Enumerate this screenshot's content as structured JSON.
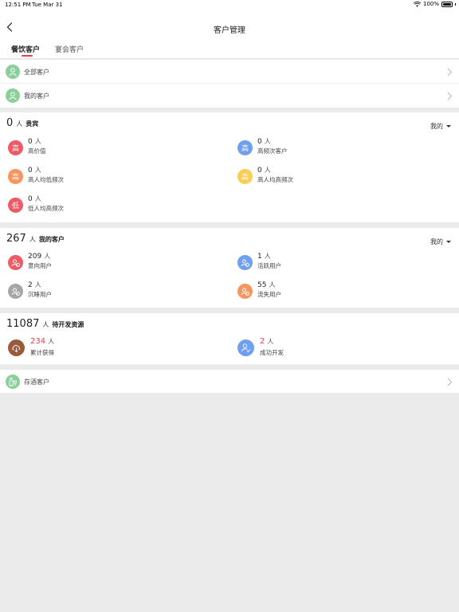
{
  "status_bar": {
    "time": "12:51 PM",
    "date": "Tue Mar 31",
    "battery": "100%"
  },
  "nav": {
    "title": "客户管理"
  },
  "tabs": [
    {
      "label": "餐饮客户",
      "active": true
    },
    {
      "label": "宴会客户",
      "active": false
    }
  ],
  "menu": {
    "all_customers": "全部客户",
    "my_customers": "我的客户",
    "wine_storage": "存酒客户"
  },
  "vip": {
    "count": "0",
    "unit": "人",
    "label": "贵宾",
    "filter": "我的",
    "items": [
      {
        "icon_text": "高",
        "color": "#ee5b66",
        "value": "0",
        "unit": "人",
        "desc": "高价值"
      },
      {
        "icon_text": "高",
        "color": "#6f9ff1",
        "value": "0",
        "unit": "人",
        "desc": "高频次客户"
      },
      {
        "icon_text": "高",
        "color": "#f7955d",
        "value": "0",
        "unit": "人",
        "desc": "高人均低频次"
      },
      {
        "icon_text": "高",
        "color": "#fbcc56",
        "value": "0",
        "unit": "人",
        "desc": "高人均高频次"
      },
      {
        "icon_text": "低",
        "color": "#ee5b66",
        "value": "0",
        "unit": "人",
        "desc": "低人均高频次"
      }
    ]
  },
  "mine": {
    "count": "267",
    "unit": "人",
    "label": "我的客户",
    "filter": "我的",
    "items": [
      {
        "icon": "users-icon",
        "color": "#ee5b66",
        "value": "209",
        "unit": "人",
        "desc": "意向用户"
      },
      {
        "icon": "users-icon",
        "color": "#6f9ff1",
        "value": "1",
        "unit": "人",
        "desc": "活跃用户"
      },
      {
        "icon": "users-icon",
        "color": "#a6a6a6",
        "value": "2",
        "unit": "人",
        "desc": "沉睡用户"
      },
      {
        "icon": "users-icon",
        "color": "#f7955d",
        "value": "55",
        "unit": "人",
        "desc": "流失用户"
      }
    ]
  },
  "pending": {
    "count": "11087",
    "unit": "人",
    "label": "待开发资源",
    "items": [
      {
        "icon": "cloud-download-icon",
        "color": "#9a5a3c",
        "value": "234",
        "unit": "人",
        "desc": "累计获得"
      },
      {
        "icon": "user-check-icon",
        "color": "#6f9ff1",
        "value": "2",
        "unit": "人",
        "desc": "成功开发"
      }
    ]
  },
  "colors": {
    "accent": "#e8414d",
    "green_icon": "#8ccf9b",
    "background": "#ebebeb"
  }
}
